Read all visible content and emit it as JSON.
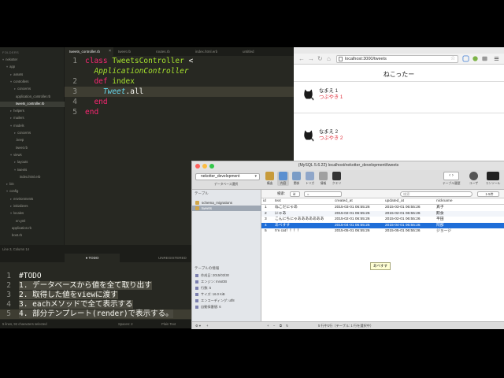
{
  "editor": {
    "sidebar_header": "FOLDERS",
    "tree": [
      {
        "label": "nekotter",
        "indent": 0,
        "arrow": "▾"
      },
      {
        "label": "app",
        "indent": 1,
        "arrow": "▾"
      },
      {
        "label": "assets",
        "indent": 2,
        "arrow": "▸"
      },
      {
        "label": "controllers",
        "indent": 2,
        "arrow": "▾"
      },
      {
        "label": "concerns",
        "indent": 3,
        "arrow": "▸"
      },
      {
        "label": "application_controller.rb",
        "indent": 3,
        "arrow": ""
      },
      {
        "label": "tweets_controller.rb",
        "indent": 3,
        "arrow": "",
        "active": true
      },
      {
        "label": "helpers",
        "indent": 2,
        "arrow": "▸"
      },
      {
        "label": "mailers",
        "indent": 2,
        "arrow": "▸"
      },
      {
        "label": "models",
        "indent": 2,
        "arrow": "▾"
      },
      {
        "label": "concerns",
        "indent": 3,
        "arrow": "▸"
      },
      {
        "label": ".keep",
        "indent": 3,
        "arrow": ""
      },
      {
        "label": "tweet.rb",
        "indent": 3,
        "arrow": ""
      },
      {
        "label": "views",
        "indent": 2,
        "arrow": "▾"
      },
      {
        "label": "layouts",
        "indent": 3,
        "arrow": "▸"
      },
      {
        "label": "tweets",
        "indent": 3,
        "arrow": "▾"
      },
      {
        "label": "index.html.erb",
        "indent": 4,
        "arrow": ""
      },
      {
        "label": "bin",
        "indent": 1,
        "arrow": "▸"
      },
      {
        "label": "config",
        "indent": 1,
        "arrow": "▾"
      },
      {
        "label": "environments",
        "indent": 2,
        "arrow": "▸"
      },
      {
        "label": "initializers",
        "indent": 2,
        "arrow": "▸"
      },
      {
        "label": "locales",
        "indent": 2,
        "arrow": "▾"
      },
      {
        "label": "en.yml",
        "indent": 3,
        "arrow": ""
      },
      {
        "label": "application.rb",
        "indent": 2,
        "arrow": ""
      },
      {
        "label": "boot.rb",
        "indent": 2,
        "arrow": ""
      }
    ],
    "tabs": [
      "tweets_controller.rb",
      "tweet.rb",
      "routes.rb",
      "index.html.erb",
      "untitled"
    ],
    "code_lines": [
      {
        "n": "1",
        "t1": "class ",
        "t2": "TweetsController",
        "t3": " < ",
        "t4": "",
        "t5": ""
      },
      {
        "n": "",
        "t1": "",
        "t2": "",
        "t3": "",
        "t4": "ApplicationController",
        "t5": ""
      },
      {
        "n": "2",
        "t1": "  def ",
        "t2": "index",
        "t3": "",
        "t4": "",
        "t5": ""
      },
      {
        "n": "3",
        "t1": "",
        "t2": "",
        "t3": "",
        "t4": "Tweet",
        "t5": ".all"
      },
      {
        "n": "4",
        "t1": "  end",
        "t2": "",
        "t3": "",
        "t4": "",
        "t5": ""
      },
      {
        "n": "5",
        "t1": "end",
        "t2": "",
        "t3": "",
        "t4": "",
        "t5": ""
      }
    ],
    "status": "Line 3, Column 14"
  },
  "todo_editor": {
    "tab_left": "● TODO",
    "tab_right": "UNREGISTERED",
    "lines": [
      {
        "n": "1",
        "text": "#TODO"
      },
      {
        "n": "2",
        "text": "1. データベースから値を全て取り出す"
      },
      {
        "n": "3",
        "text": "2. 取得した値をviewに渡す"
      },
      {
        "n": "4",
        "text": "3. eachメソッドで全て表示する"
      },
      {
        "n": "5",
        "text": "4. 部分テンプレート(render)で表示する。"
      }
    ],
    "status_left": "5 lines, 92 characters selected",
    "status_mid": "Spaces: 2",
    "status_right": "Plain Text"
  },
  "browser": {
    "url": "localhost:3000/tweets",
    "page_title": "ねこったー",
    "tweets": [
      {
        "name": "なまえ 1",
        "text": "つぶやき 1"
      },
      {
        "name": "なまえ 2",
        "text": "つぶやき 2"
      }
    ]
  },
  "sequel": {
    "title": "(MySQL 5.6.22) localhost/nekotter_development/tweets",
    "database": "nekotter_development",
    "database_caption": "データベース選択",
    "toolbar": [
      "構造",
      "内容",
      "関係",
      "トリガ",
      "情報",
      "クエリ"
    ],
    "toolbar_right": [
      "テーブル履歴",
      "ユーザ",
      "コンソール"
    ],
    "tables_header": "テーブル",
    "tables": [
      "schema_migrations",
      "tweets"
    ],
    "info_header": "テーブルの情報",
    "info": [
      "作成日: 2015/03/30",
      "エンジン: InnoDB",
      "行数: 5",
      "サイズ: 16.0 KiB",
      "エンコーディング: utf8",
      "自動採番値: 6"
    ],
    "filter_label": "検索:",
    "filter_field": "id",
    "filter_op": "=",
    "filter_placeholder": "検索",
    "filter_count": "1-5件",
    "columns": [
      "id",
      "text",
      "created_at",
      "updated_at",
      "nickname"
    ],
    "rows": [
      [
        "1",
        "ねこだにゃあ",
        "2015-03-01 06:55:26",
        "2015-03-01 06:55:26",
        "真子"
      ],
      [
        "2",
        "にゃあ",
        "2015-02-01 06:55:26",
        "2015-02-01 06:55:26",
        "飲食"
      ],
      [
        "3",
        "こんにちにゃあああああああ",
        "2015-02-01 06:55:26",
        "2015-02-01 06:55:26",
        "平田"
      ],
      [
        "4",
        "あべすす",
        "2015-04-01 06:55:26",
        "2015-04-01 06:55:26",
        "阿部"
      ],
      [
        "5",
        "I'm cat！！！！",
        "2015-05-01 06:55:26",
        "2015-05-01 06:55:26",
        "ジョージ"
      ]
    ],
    "selected_row": 3,
    "tooltip": "あべすす",
    "bottom_status": "5 行中1行（テーブル: 1 行を選択中）"
  },
  "colors": {
    "editor_bg": "#272822",
    "keyword": "#f92672",
    "class_name": "#a6e22e",
    "tweet_red": "#e0303c",
    "row_selected": "#1f6ed8"
  }
}
